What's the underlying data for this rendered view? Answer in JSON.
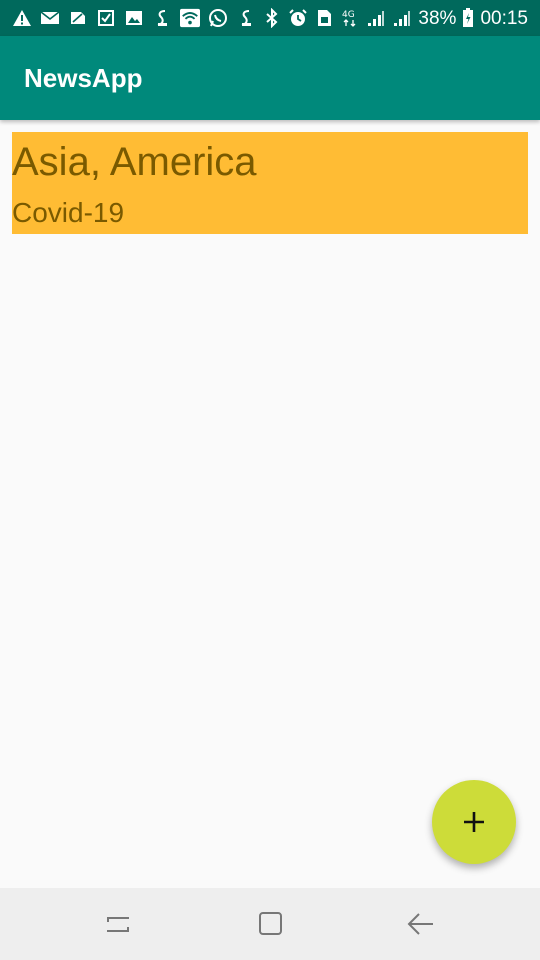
{
  "status_bar": {
    "battery_percent": "38%",
    "time": "00:15",
    "left_icons": [
      "warning-icon",
      "mail-icon",
      "sim-icon",
      "checkbox-icon",
      "image-icon",
      "app-icon",
      "wifi-icon",
      "whatsapp-icon",
      "app-icon"
    ],
    "right_icons": [
      "bluetooth-icon",
      "alarm-icon",
      "sim-card-icon",
      "network-4g-icon",
      "signal-icon",
      "signal-icon",
      "battery-icon"
    ],
    "background_color": "#00695c"
  },
  "app_bar": {
    "title": "NewsApp",
    "background_color": "#00897b"
  },
  "news_list": [
    {
      "title": "Asia, America",
      "subtitle": "Covid-19",
      "background_color": "#ffbc34",
      "text_color": "#7a5a00"
    }
  ],
  "fab": {
    "icon": "plus-icon",
    "color": "#cddc39"
  },
  "nav_bar": {
    "buttons": [
      "recent-apps-icon",
      "home-icon",
      "back-icon"
    ],
    "background_color": "#eeeeee"
  }
}
